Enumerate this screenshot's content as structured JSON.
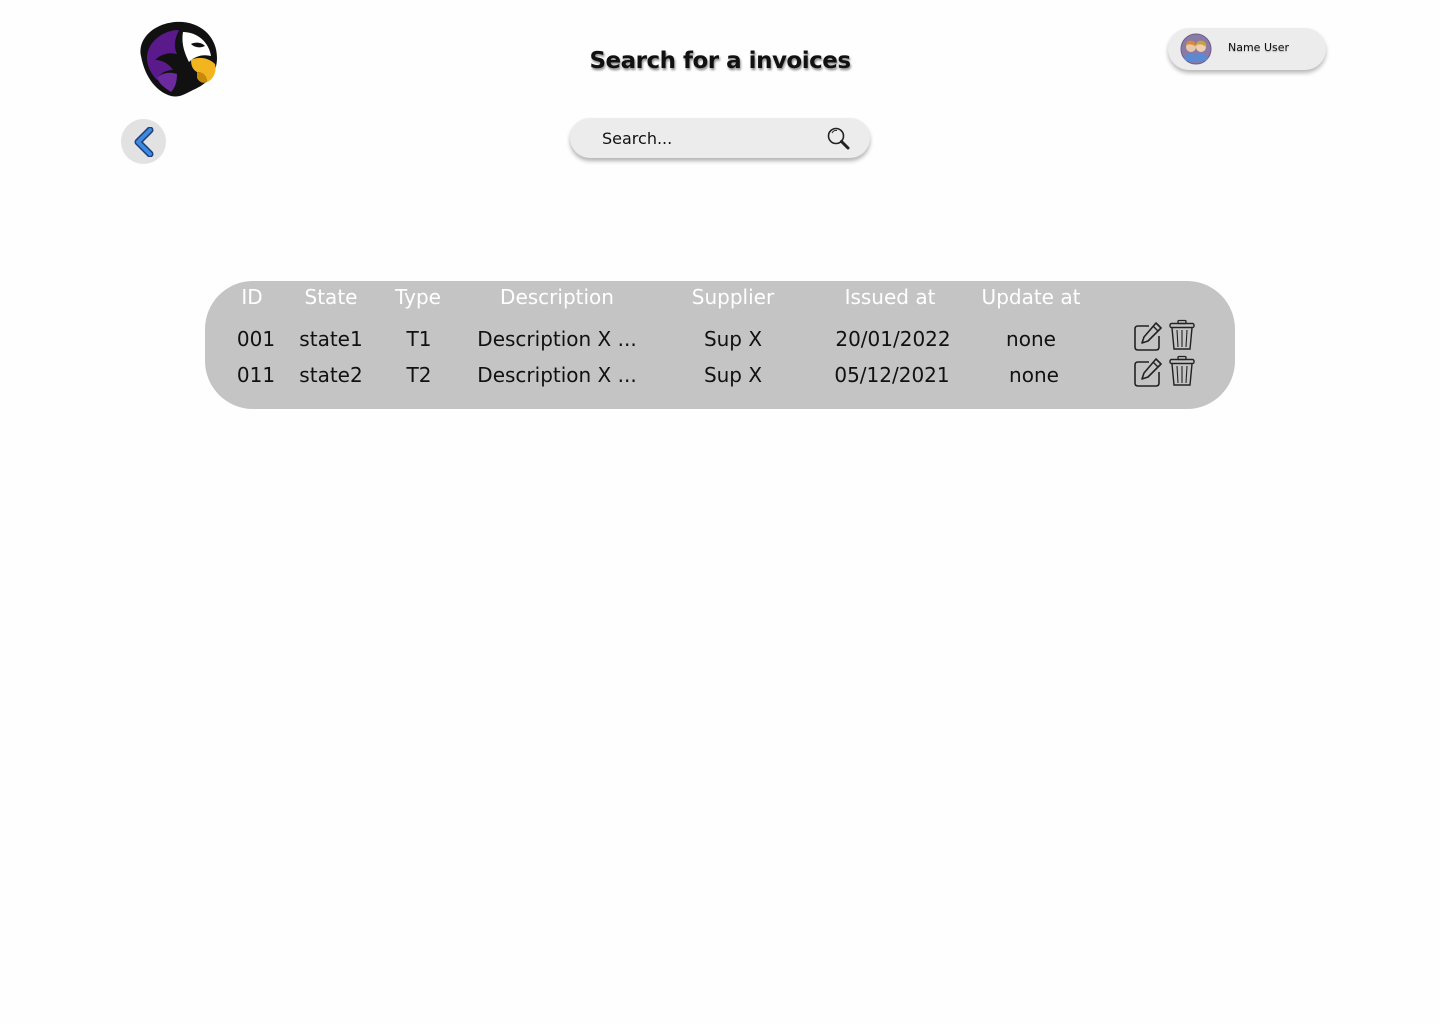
{
  "header": {
    "title": "Search for a invoices",
    "user_name": "Name User"
  },
  "search": {
    "placeholder": "Search..."
  },
  "icons": {
    "logo": "hawk-logo",
    "avatar": "user-avatar",
    "back": "chevron-left-icon",
    "search": "search-icon",
    "edit": "edit-icon",
    "delete": "trash-icon"
  },
  "colors": {
    "table_background": "#c4c4c4",
    "header_text": "#ffffff",
    "accent_blue": "#2f7ad4",
    "logo_purple": "#5a1a8c"
  },
  "table": {
    "headers": [
      "ID",
      "State",
      "Type",
      "Description",
      "Supplier",
      "Issued at",
      "Update at"
    ],
    "rows": [
      {
        "id": "001",
        "state": "state1",
        "type": "T1",
        "description": "Description X ...",
        "supplier": "Sup X",
        "issued_at": "20/01/2022",
        "update_at": "none"
      },
      {
        "id": "011",
        "state": "state2",
        "type": "T2",
        "description": "Description X ...",
        "supplier": "Sup X",
        "issued_at": "05/12/2021",
        "update_at": "none"
      }
    ]
  }
}
